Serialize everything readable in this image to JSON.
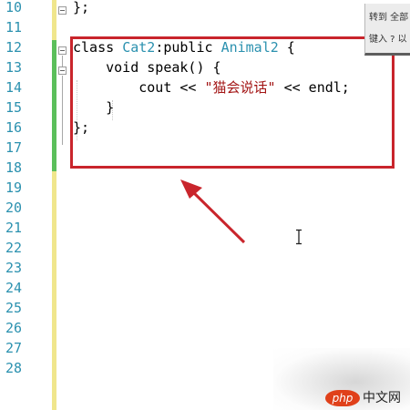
{
  "editor": {
    "line_numbers": [
      "10",
      "11",
      "12",
      "13",
      "14",
      "15",
      "16",
      "17",
      "18",
      "19",
      "20",
      "21",
      "22",
      "23",
      "24",
      "25",
      "26",
      "27",
      "28"
    ],
    "lines": [
      {
        "segments": [
          {
            "text": "};",
            "kind": "plain"
          }
        ]
      },
      {
        "segments": []
      },
      {
        "segments": [
          {
            "text": "class ",
            "kind": "plain"
          },
          {
            "text": "Cat2",
            "kind": "type"
          },
          {
            "text": ":public ",
            "kind": "plain"
          },
          {
            "text": "Animal2",
            "kind": "type"
          },
          {
            "text": " {",
            "kind": "plain"
          }
        ]
      },
      {
        "segments": [
          {
            "text": "    void speak() {",
            "kind": "plain"
          }
        ]
      },
      {
        "segments": [
          {
            "text": "        cout << ",
            "kind": "plain"
          },
          {
            "text": "\"猫会说话\"",
            "kind": "str"
          },
          {
            "text": " << endl;",
            "kind": "plain"
          }
        ]
      },
      {
        "segments": [
          {
            "text": "    }",
            "kind": "plain"
          }
        ]
      },
      {
        "segments": [
          {
            "text": "};",
            "kind": "plain"
          }
        ]
      }
    ],
    "colors": {
      "line_number": "#2b91af",
      "type": "#2b91af",
      "string": "#a31515",
      "changed_bar_saved": "#5bbf5b",
      "changed_bar_unsaved": "#f0e68c",
      "highlight_box": "#c9252c"
    }
  },
  "find_panel": {
    "line1": "转到 全部",
    "line2": "键入 ? 以"
  },
  "watermark": {
    "logo": "php",
    "text": "中文网"
  },
  "icons": {
    "cursor": "ibeam-cursor-icon",
    "arrow": "red-arrow-icon",
    "fold": "collapse-icon"
  }
}
